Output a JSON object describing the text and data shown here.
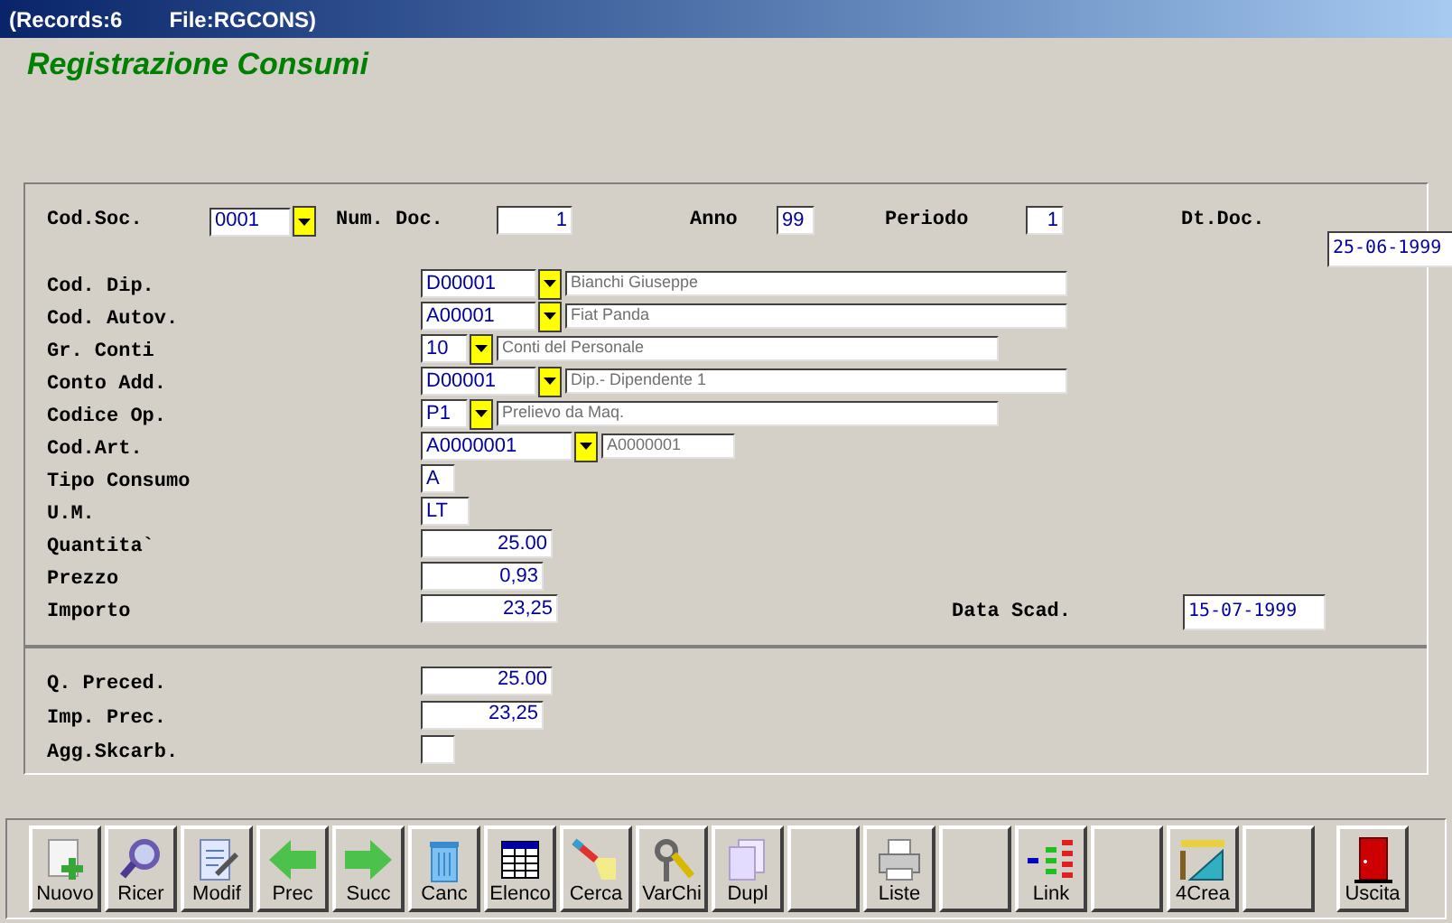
{
  "window": {
    "title_parts": [
      "(Records:6",
      "File:RGCONS)"
    ]
  },
  "heading": "Registrazione Consumi",
  "top_row": [
    {
      "label": "Cod.Soc.",
      "value": "0001",
      "kind": "combo"
    },
    {
      "label": "Num. Doc.",
      "value": "1",
      "kind": "number"
    },
    {
      "label": "Anno",
      "value": "99",
      "kind": "text"
    },
    {
      "label": "Periodo",
      "value": "1",
      "kind": "number"
    },
    {
      "label": "Dt.Doc.",
      "value": "25-06-1999",
      "kind": "date"
    }
  ],
  "detail_rows": [
    {
      "label": "Cod. Dip.",
      "kind": "lookup",
      "value": "D00001",
      "description": "Bianchi Giuseppe"
    },
    {
      "label": "Cod. Autov.",
      "kind": "lookup",
      "value": "A00001",
      "description": "Fiat Panda"
    },
    {
      "label": "Gr. Conti",
      "kind": "lookup",
      "value": "10",
      "description": "Conti del Personale"
    },
    {
      "label": "Conto Add.",
      "kind": "lookup",
      "value": "D00001",
      "description": "Dip.- Dipendente 1"
    },
    {
      "label": "Codice Op.",
      "kind": "lookup",
      "value": "P1",
      "description": "Prelievo da Maq."
    },
    {
      "label": "Cod.Art.",
      "kind": "lookup",
      "value": "A0000001",
      "description": "A0000001"
    },
    {
      "label": "Tipo Consumo",
      "kind": "text",
      "value": "A"
    },
    {
      "label": "U.M.",
      "kind": "text",
      "value": "LT"
    },
    {
      "label": "Quantita`",
      "kind": "number",
      "value": "25.00"
    },
    {
      "label": "Prezzo",
      "kind": "number",
      "value": "0,93"
    },
    {
      "label": "Importo",
      "kind": "number",
      "value": "23,25",
      "side": {
        "label": "Data Scad.",
        "value": "15-07-1999"
      }
    }
  ],
  "lower_rows": [
    {
      "label": "Q. Preced.",
      "kind": "number",
      "value": "25.00"
    },
    {
      "label": "Imp. Prec.",
      "kind": "number",
      "value": "23,25"
    },
    {
      "label": "Agg.Skcarb.",
      "kind": "blank"
    }
  ],
  "toolbar": [
    {
      "kind": "new",
      "label": "Nuovo"
    },
    {
      "kind": "search",
      "label": "Ricer"
    },
    {
      "kind": "edit",
      "label": "Modif"
    },
    {
      "kind": "prev",
      "label": "Prec"
    },
    {
      "kind": "next",
      "label": "Succ"
    },
    {
      "kind": "delete",
      "label": "Canc"
    },
    {
      "kind": "list",
      "label": "Elenco"
    },
    {
      "kind": "find",
      "label": "Cerca"
    },
    {
      "kind": "keys",
      "label": "VarChi"
    },
    {
      "kind": "copy",
      "label": "Dupl"
    },
    {
      "kind": "empty"
    },
    {
      "kind": "print",
      "label": "Liste"
    },
    {
      "kind": "empty"
    },
    {
      "kind": "link",
      "label": "Link"
    },
    {
      "kind": "empty"
    },
    {
      "kind": "create",
      "label": "4Crea"
    },
    {
      "kind": "empty"
    },
    {
      "kind": "exit",
      "label": "Uscita"
    }
  ]
}
